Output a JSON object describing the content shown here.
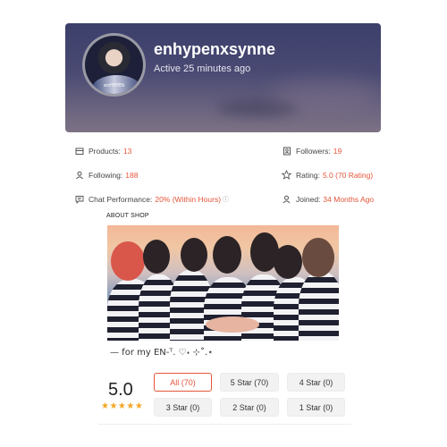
{
  "shop": {
    "name": "enhypenxsynne",
    "status": "Active 25 minutes ago",
    "avatar_logo_text": "enHYPEN"
  },
  "stats": {
    "products_label": "Products:",
    "products_value": "13",
    "followers_label": "Followers:",
    "followers_value": "19",
    "following_label": "Following:",
    "following_value": "188",
    "rating_label": "Rating:",
    "rating_value": "5.0 (70 Rating)",
    "chat_label": "Chat Performance:",
    "chat_value": "20% (Within Hours)",
    "joined_label": "Joined:",
    "joined_value": "34 Months Ago"
  },
  "about": {
    "title": "ABOUT SHOP",
    "caption": "— for my EN-ᵀ. ♡˖ ⊹˚.⋆"
  },
  "reviews": {
    "score": "5.0",
    "stars_display": "★★★★★",
    "stars_value": 5,
    "filters": [
      {
        "label": "All (70)",
        "active": true
      },
      {
        "label": "5 Star (70)",
        "active": false
      },
      {
        "label": "4 Star (0)",
        "active": false
      },
      {
        "label": "3 Star (0)",
        "active": false
      },
      {
        "label": "2 Star (0)",
        "active": false
      },
      {
        "label": "1 Star (0)",
        "active": false
      }
    ]
  },
  "colors": {
    "accent": "#e4553a",
    "star": "#f5a623",
    "header_bg": "#3b3f6a"
  }
}
